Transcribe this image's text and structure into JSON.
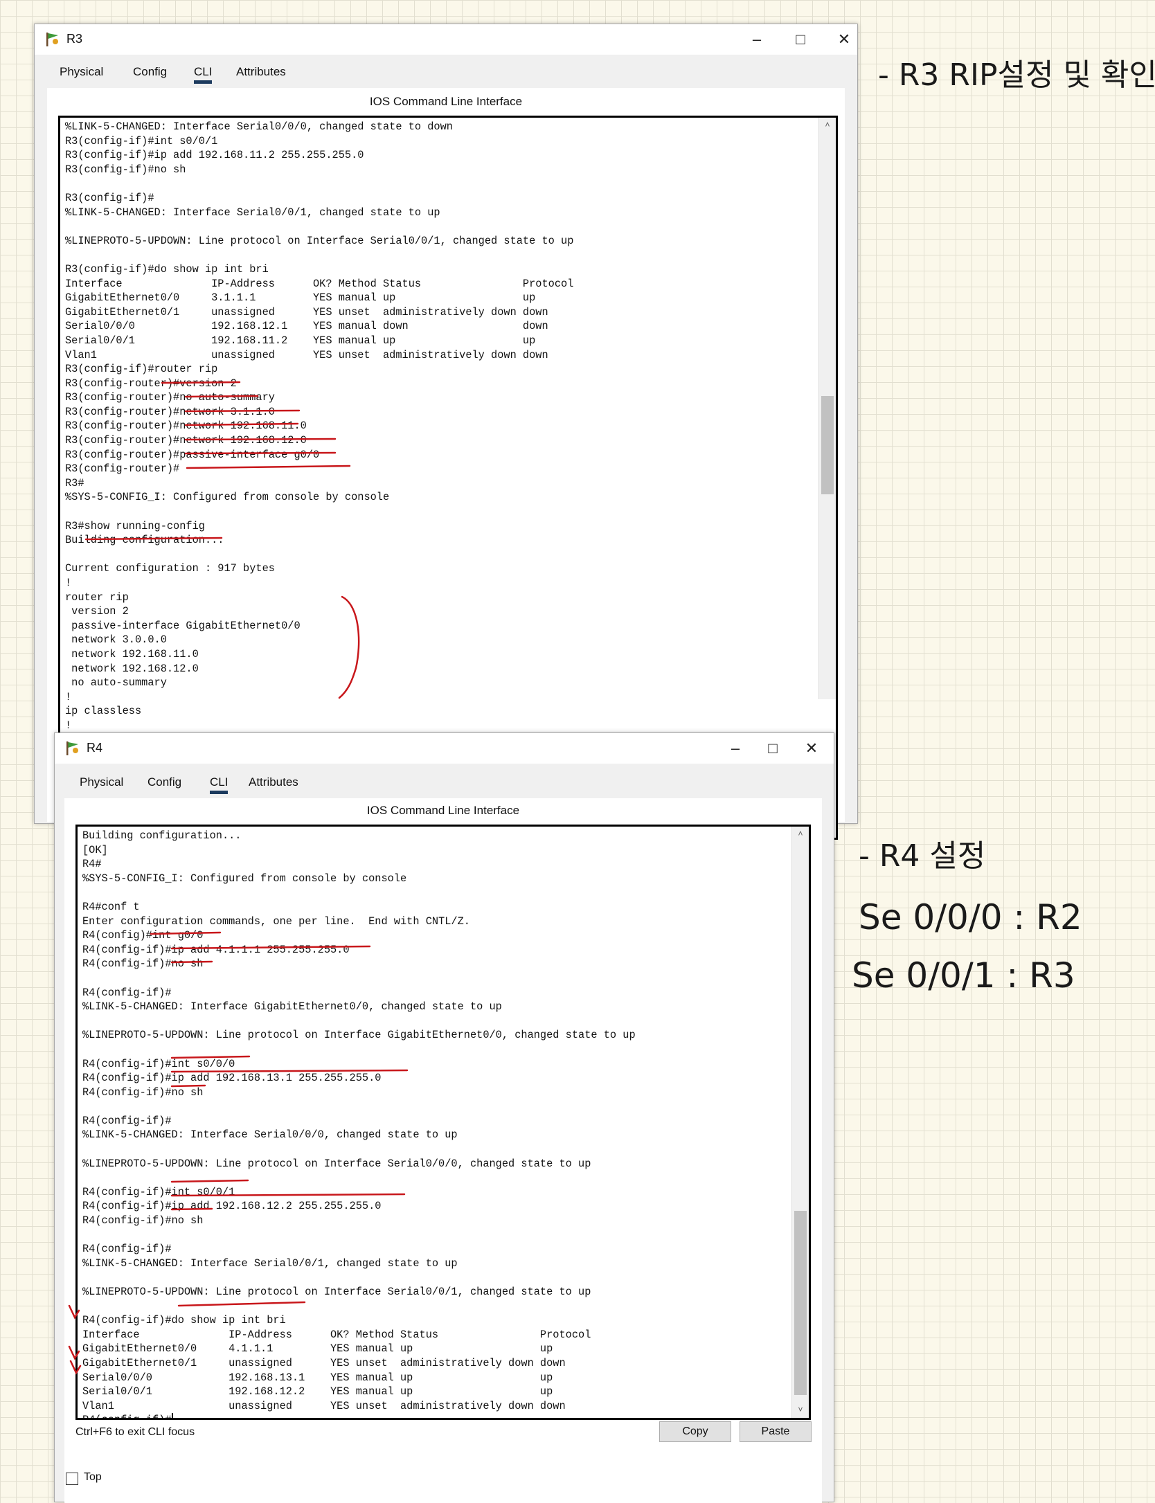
{
  "r3": {
    "title": "R3",
    "tabs": [
      "Physical",
      "Config",
      "CLI",
      "Attributes"
    ],
    "active_tab": "CLI",
    "cli_label": "IOS Command Line Interface",
    "lines": [
      "%LINK-5-CHANGED: Interface Serial0/0/0, changed state to down",
      "R3(config-if)#int s0/0/1",
      "R3(config-if)#ip add 192.168.11.2 255.255.255.0",
      "R3(config-if)#no sh",
      "",
      "R3(config-if)#",
      "%LINK-5-CHANGED: Interface Serial0/0/1, changed state to up",
      "",
      "%LINEPROTO-5-UPDOWN: Line protocol on Interface Serial0/0/1, changed state to up",
      "",
      "R3(config-if)#do show ip int bri",
      "Interface              IP-Address      OK? Method Status                Protocol",
      "GigabitEthernet0/0     3.1.1.1         YES manual up                    up",
      "GigabitEthernet0/1     unassigned      YES unset  administratively down down",
      "Serial0/0/0            192.168.12.1    YES manual down                  down",
      "Serial0/0/1            192.168.11.2    YES manual up                    up",
      "Vlan1                  unassigned      YES unset  administratively down down",
      "R3(config-if)#router rip",
      "R3(config-router)#version 2",
      "R3(config-router)#no auto-summary",
      "R3(config-router)#network 3.1.1.0",
      "R3(config-router)#network 192.168.11.0",
      "R3(config-router)#network 192.168.12.0",
      "R3(config-router)#passive-interface g0/0",
      "R3(config-router)#",
      "R3#",
      "%SYS-5-CONFIG_I: Configured from console by console",
      "",
      "R3#show running-config",
      "Building configuration...",
      "",
      "Current configuration : 917 bytes",
      "!",
      "router rip",
      " version 2",
      " passive-interface GigabitEthernet0/0",
      " network 3.0.0.0",
      " network 192.168.11.0",
      " network 192.168.12.0",
      " no auto-summary",
      "!",
      "ip classless",
      "!"
    ]
  },
  "r4": {
    "title": "R4",
    "tabs": [
      "Physical",
      "Config",
      "CLI",
      "Attributes"
    ],
    "active_tab": "CLI",
    "cli_label": "IOS Command Line Interface",
    "lines": [
      "Building configuration...",
      "[OK]",
      "R4#",
      "%SYS-5-CONFIG_I: Configured from console by console",
      "",
      "R4#conf t",
      "Enter configuration commands, one per line.  End with CNTL/Z.",
      "R4(config)#int g0/0",
      "R4(config-if)#ip add 4.1.1.1 255.255.255.0",
      "R4(config-if)#no sh",
      "",
      "R4(config-if)#",
      "%LINK-5-CHANGED: Interface GigabitEthernet0/0, changed state to up",
      "",
      "%LINEPROTO-5-UPDOWN: Line protocol on Interface GigabitEthernet0/0, changed state to up",
      "",
      "R4(config-if)#int s0/0/0",
      "R4(config-if)#ip add 192.168.13.1 255.255.255.0",
      "R4(config-if)#no sh",
      "",
      "R4(config-if)#",
      "%LINK-5-CHANGED: Interface Serial0/0/0, changed state to up",
      "",
      "%LINEPROTO-5-UPDOWN: Line protocol on Interface Serial0/0/0, changed state to up",
      "",
      "R4(config-if)#int s0/0/1",
      "R4(config-if)#ip add 192.168.12.2 255.255.255.0",
      "R4(config-if)#no sh",
      "",
      "R4(config-if)#",
      "%LINK-5-CHANGED: Interface Serial0/0/1, changed state to up",
      "",
      "%LINEPROTO-5-UPDOWN: Line protocol on Interface Serial0/0/1, changed state to up",
      "",
      "R4(config-if)#do show ip int bri",
      "Interface              IP-Address      OK? Method Status                Protocol",
      "GigabitEthernet0/0     4.1.1.1         YES manual up                    up",
      "GigabitEthernet0/1     unassigned      YES unset  administratively down down",
      "Serial0/0/0            192.168.13.1    YES manual up                    up",
      "Serial0/0/1            192.168.12.2    YES manual up                    up",
      "Vlan1                  unassigned      YES unset  administratively down down",
      "R4(config-if)#"
    ],
    "hint": "Ctrl+F6 to exit CLI focus",
    "copy_label": "Copy",
    "paste_label": "Paste",
    "top_label": "Top"
  },
  "notes": {
    "r3_note": "- R3 RIP설정 및 확인",
    "r4_note": "- R4 설정",
    "r4_line1": "Se 0/0/0 : R2",
    "r4_line2": "Se 0/0/1 : R3"
  },
  "colors": {
    "annotation": "#c8171b",
    "tab_underline": "#1c3a5e"
  }
}
